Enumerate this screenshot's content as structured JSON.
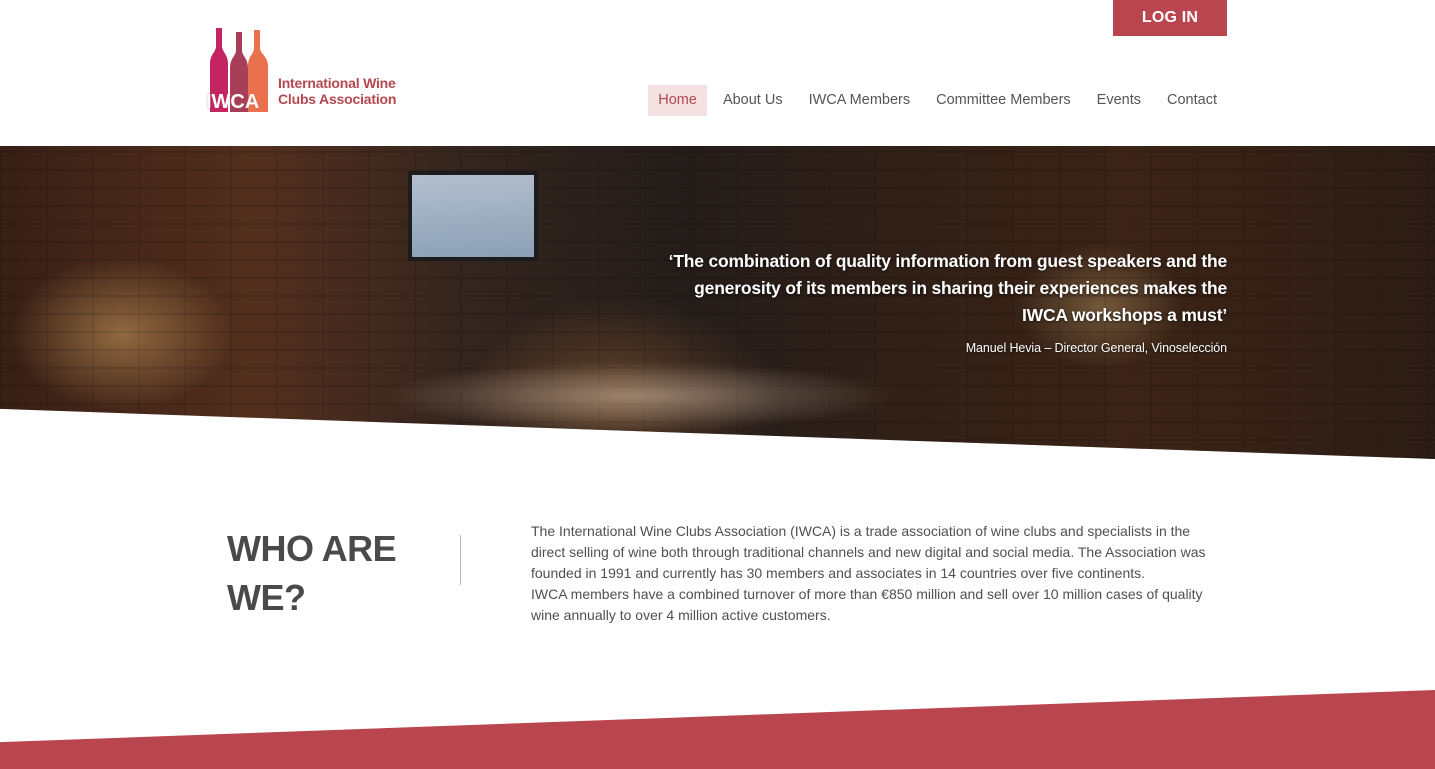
{
  "header": {
    "logo": {
      "abbrev": "IWCA",
      "name": "International Wine Clubs Association",
      "bottle_colors": [
        "#c2185b",
        "#9c2a45",
        "#e8623a"
      ]
    },
    "login_label": "LOG IN",
    "nav": [
      {
        "label": "Home",
        "active": true
      },
      {
        "label": "About Us",
        "active": false
      },
      {
        "label": "IWCA Members",
        "active": false
      },
      {
        "label": "Committee Members",
        "active": false
      },
      {
        "label": "Events",
        "active": false
      },
      {
        "label": "Contact",
        "active": false
      }
    ]
  },
  "hero": {
    "quote": "‘The combination of quality information from guest speakers and the generosity of its members in sharing their experiences makes the IWCA workshops a must’",
    "author": "Manuel Hevia – Director General, Vinoselección"
  },
  "about": {
    "title": "WHO ARE WE?",
    "paragraphs": [
      "The International Wine Clubs Association (IWCA) is a trade association of wine clubs and specialists in the direct selling of wine both through traditional channels and new digital and social media. The Association was founded in 1991 and currently has 30 members and associates in 14 countries over five continents.",
      "IWCA members have a combined turnover of more than €850 million and sell over 10 million cases of quality wine annually to over 4 million active customers."
    ]
  },
  "colors": {
    "accent": "#b9464e",
    "nav_active_bg": "#f4e2e3",
    "text": "#4a4a4a"
  }
}
